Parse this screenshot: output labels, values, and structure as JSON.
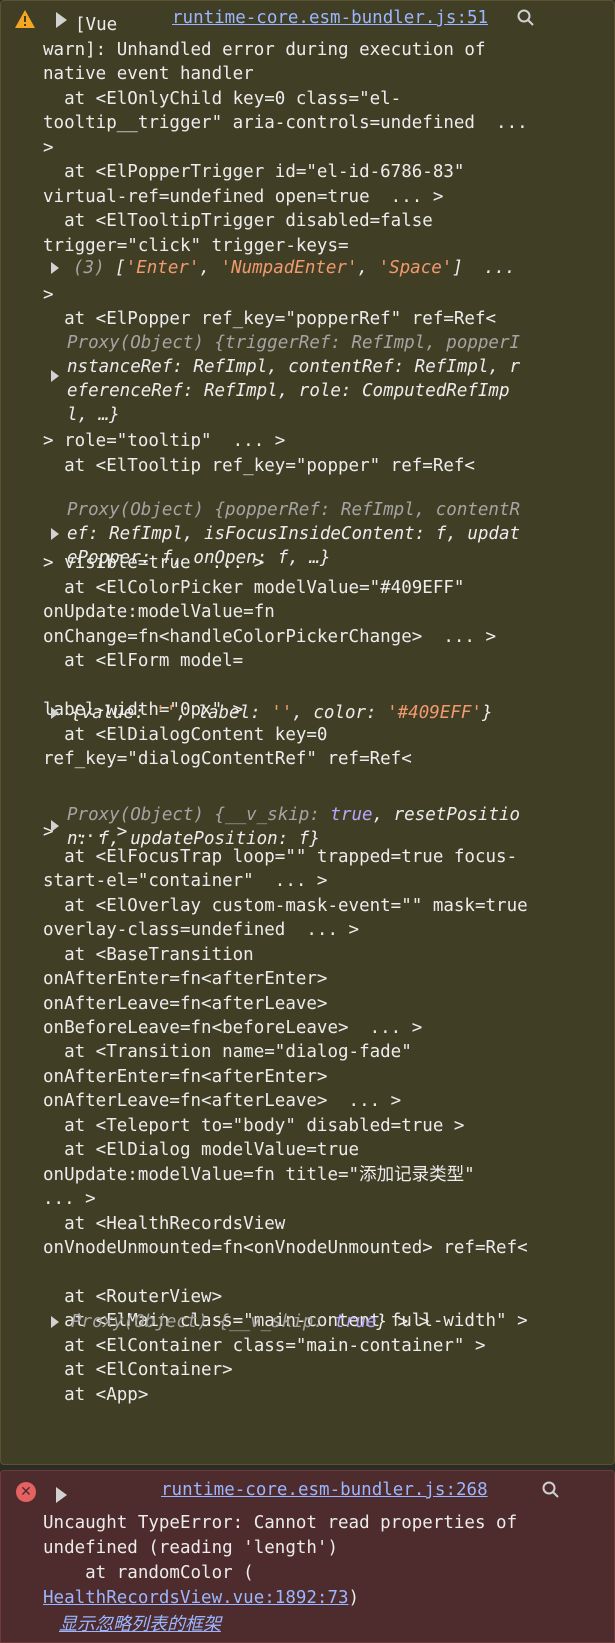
{
  "warning": {
    "header_text": "[Vue",
    "source_link": "runtime-core.esm-bundler.js:51",
    "lines": [
      "warn]: Unhandled error during execution of",
      "native event handler",
      "  at <ElOnlyChild key=0 class=\"el-",
      "tooltip__trigger\" aria-controls=undefined  ...",
      ">",
      "  at <ElPopperTrigger id=\"el-id-6786-83\"",
      "virtual-ref=undefined open=true  ... >",
      "  at <ElTooltipTrigger disabled=false",
      "trigger=\"click\" trigger-keys=",
      "",
      ">",
      "  at <ElPopper ref_key=\"popperRef\" ref=Ref<",
      "",
      "",
      "",
      "",
      "> role=\"tooltip\"  ... >",
      "  at <ElTooltip ref_key=\"popper\" ref=Ref<",
      "",
      "",
      "",
      "> visible=true  ... >",
      "  at <ElColorPicker modelValue=\"#409EFF\"",
      "onUpdate:modelValue=fn",
      "onChange=fn<handleColorPickerChange>  ... >",
      "  at <ElForm model=",
      "",
      "label-width=\"0px\" >",
      "  at <ElDialogContent key=0",
      "ref_key=\"dialogContentRef\" ref=Ref<",
      "",
      "",
      ">  ... >",
      "  at <ElFocusTrap loop=\"\" trapped=true focus-",
      "start-el=\"container\"  ... >",
      "  at <ElOverlay custom-mask-event=\"\" mask=true",
      "overlay-class=undefined  ... >",
      "  at <BaseTransition",
      "onAfterEnter=fn<afterEnter>",
      "onAfterLeave=fn<afterLeave>",
      "onBeforeLeave=fn<beforeLeave>  ... >",
      "  at <Transition name=\"dialog-fade\"",
      "onAfterEnter=fn<afterEnter>",
      "onAfterLeave=fn<afterLeave>  ... >",
      "  at <Teleport to=\"body\" disabled=true >",
      "  at <ElDialog modelValue=true",
      "onUpdate:modelValue=fn title=\"添加记录类型\"",
      "... >",
      "  at <HealthRecordsView",
      "onVnodeUnmounted=fn<onVnodeUnmounted> ref=Ref<",
      "",
      "  at <RouterView>",
      "  at <ElMain class=\"main-content full-width\" >",
      "  at <ElContainer class=\"main-container\" >",
      "  at <ElContainer>",
      "  at <App>"
    ],
    "trigger_keys_count": "(3)",
    "trigger_keys_open": " [",
    "trigger_key_1": "'Enter'",
    "sep": ", ",
    "trigger_key_2": "'NumpadEnter'",
    "trigger_key_3": "'Space'",
    "trigger_keys_close": "]  ...",
    "popper_ref": [
      "Proxy(Object) {triggerRef: RefImpl, popperI",
      "nstanceRef: RefImpl, contentRef: RefImpl, r",
      "eferenceRef: RefImpl, role: ComputedRefImp",
      "l, …}"
    ],
    "tooltip_ref": [
      "Proxy(Object) {popperRef: RefImpl, contentR",
      "ef: RefImpl, isFocusInsideContent: f, updat",
      "ePopper: f, onOpen: f, …}"
    ],
    "form_model_open": "{value: ",
    "form_value": "''",
    "form_label_key": ", label: ",
    "form_label": "''",
    "form_color_key": ", color: ",
    "form_color": "'#409EFF'",
    "form_model_close": "}",
    "dialog_ref_1a": "Proxy(Object) {__v_skip: ",
    "dialog_ref_true": "true",
    "dialog_ref_1b": ", resetPositio",
    "dialog_ref_2": "n: f, updatePosition: f}",
    "hrv_ref_a": "Proxy(Object) {__v_skip: ",
    "hrv_ref_true": "true",
    "hrv_ref_b": "} > >"
  },
  "error": {
    "source_link": "runtime-core.esm-bundler.js:268",
    "lines": [
      "Uncaught TypeError: Cannot read properties of",
      "undefined (reading 'length')",
      "    at randomColor ("
    ],
    "location_link": "HealthRecordsView.vue:1892:73",
    "location_close": ")",
    "show_ignored_frames": "显示忽略列表的框架"
  },
  "colors": {
    "warning_bg": "#413e26",
    "error_bg": "#4e2b2c",
    "link": "#9bb6ff",
    "string": "#f09a6e",
    "keyword": "#b7a8ff"
  }
}
